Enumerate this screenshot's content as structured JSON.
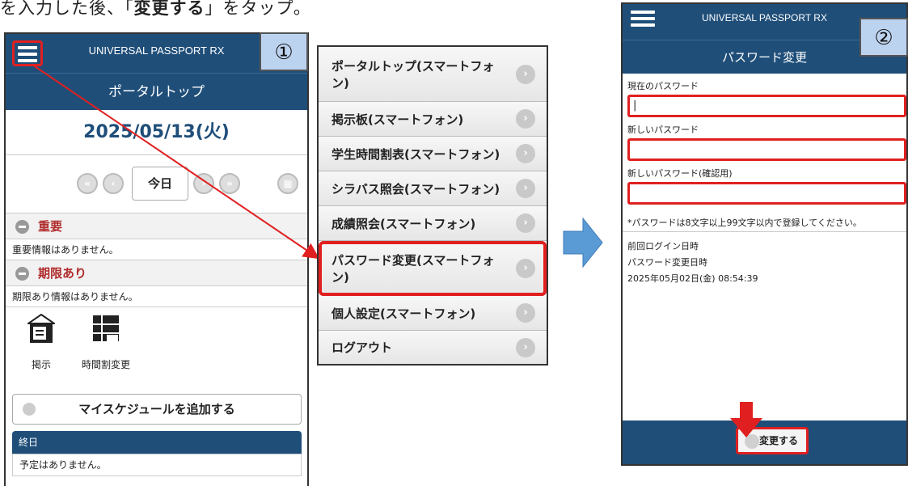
{
  "caption": {
    "before": "を入力した後、「",
    "bold": "変更する",
    "after": "」をタップ。"
  },
  "step_badges": [
    "①",
    "②"
  ],
  "phone1": {
    "app_title": "UNIVERSAL PASSPORT RX",
    "page_title": "ポータルトップ",
    "date": "2025/05/13(火)",
    "today_button": "今日",
    "important_heading": "重要",
    "important_text": "重要情報はありません。",
    "deadline_heading": "期限あり",
    "deadline_text": "期限あり情報はありません。",
    "tiles": [
      {
        "label": "掲示",
        "icon": "bulletin-board-icon"
      },
      {
        "label": "時間割変更",
        "icon": "timetable-change-icon"
      }
    ],
    "my_schedule_button": "マイスケジュールを追加する",
    "allday_heading": "終日",
    "allday_text": "予定はありません。"
  },
  "menu": {
    "items": [
      "ポータルトップ(スマートフォン)",
      "掲示板(スマートフォン)",
      "学生時間割表(スマートフォン)",
      "シラバス照会(スマートフォン)",
      "成績照会(スマートフォン)",
      "パスワード変更(スマートフォン)",
      "個人設定(スマートフォン)",
      "ログアウト"
    ],
    "highlighted_index": 5
  },
  "phone2": {
    "app_title": "UNIVERSAL PASSPORT RX",
    "page_title": "パスワード変更",
    "current_password_label": "現在のパスワード",
    "current_password_value": "|",
    "new_password_label": "新しいパスワード",
    "confirm_password_label": "新しいパスワード(確認用)",
    "note": "*パスワードは8文字以上99文字以内で登録してください。",
    "last_login_label": "前回ログイン日時",
    "password_changed_label": "パスワード変更日時",
    "password_changed_value": "2025年05月02日(金) 08:54:39",
    "submit_button": "変更する"
  },
  "colors": {
    "header": "#1f4e79",
    "highlight": "#e02020",
    "badge": "#bcd3f0",
    "arrow": "#5b9bd5"
  }
}
